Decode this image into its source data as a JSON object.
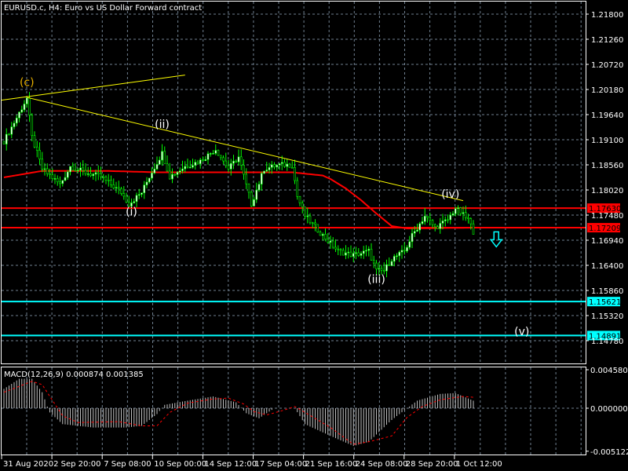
{
  "title": "EURUSD.c, H4:  Euro vs US Dollar Forward contract",
  "macd_label": "MACD(12,26,9) 0.000874 0.001385",
  "colors": {
    "bg": "#000000",
    "grid": "#708090",
    "candle": "#00ff00",
    "body_up": "#ffffff",
    "body_down": "#000000",
    "ma": "#ff0000",
    "trend": "#ffff00",
    "support": "#00ffff",
    "resist": "#ff0000",
    "signal": "#ff0000",
    "hist": "#c0c0c0"
  },
  "chart_data": [
    {
      "type": "candlestick",
      "symbol": "EURUSD.c",
      "timeframe": "H4",
      "ylim": [
        1.1451,
        1.2208
      ],
      "y_ticks": [
        "1.21800",
        "1.21260",
        "1.20720",
        "1.20180",
        "1.19640",
        "1.19100",
        "1.18560",
        "1.18020",
        "1.17480",
        "1.16940",
        "1.16400",
        "1.15860",
        "1.15320",
        "1.14780"
      ],
      "x_ticks": [
        "31 Aug 2020",
        "2 Sep 20:00",
        "7 Sep 08:00",
        "10 Sep 00:00",
        "14 Sep 12:00",
        "17 Sep 04:00",
        "21 Sep 16:00",
        "24 Sep 08:00",
        "28 Sep 20:00",
        "1 Oct 12:00"
      ],
      "bar_count": 185,
      "close_path": [
        [
          0,
          1.19066
        ],
        [
          5,
          1.19573
        ],
        [
          9,
          1.19994
        ],
        [
          11,
          1.19151
        ],
        [
          15,
          1.18476
        ],
        [
          22,
          1.18138
        ],
        [
          26,
          1.18526
        ],
        [
          32,
          1.18391
        ],
        [
          38,
          1.18307
        ],
        [
          46,
          1.17969
        ],
        [
          49,
          1.17716
        ],
        [
          54,
          1.17969
        ],
        [
          57,
          1.18307
        ],
        [
          62,
          1.18813
        ],
        [
          65,
          1.18307
        ],
        [
          71,
          1.18526
        ],
        [
          77,
          1.18644
        ],
        [
          83,
          1.18898
        ],
        [
          88,
          1.18476
        ],
        [
          92,
          1.18729
        ],
        [
          97,
          1.17716
        ],
        [
          102,
          1.18476
        ],
        [
          108,
          1.1856
        ],
        [
          113,
          1.1856
        ],
        [
          115,
          1.17885
        ],
        [
          118,
          1.17463
        ],
        [
          125,
          1.17041
        ],
        [
          131,
          1.16704
        ],
        [
          137,
          1.16619
        ],
        [
          143,
          1.16704
        ],
        [
          146,
          1.16282
        ],
        [
          149,
          1.16282
        ],
        [
          152,
          1.16535
        ],
        [
          157,
          1.16704
        ],
        [
          160,
          1.17041
        ],
        [
          165,
          1.17463
        ],
        [
          169,
          1.1721
        ],
        [
          174,
          1.17379
        ],
        [
          177,
          1.17632
        ],
        [
          182,
          1.17379
        ],
        [
          184,
          1.17126
        ]
      ],
      "moving_average": [
        [
          0,
          1.1829
        ],
        [
          15,
          1.1843
        ],
        [
          40,
          1.1843
        ],
        [
          60,
          1.184
        ],
        [
          113,
          1.184
        ],
        [
          125,
          1.1833
        ],
        [
          128,
          1.18256
        ],
        [
          134,
          1.18054
        ],
        [
          140,
          1.178
        ],
        [
          146,
          1.17514
        ],
        [
          152,
          1.17244
        ],
        [
          158,
          1.17193
        ],
        [
          184,
          1.1721
        ]
      ],
      "horizontal_levels": [
        {
          "label": "1.17630",
          "value": 1.1763,
          "kind": "resistance"
        },
        {
          "label": "1.17209",
          "value": 1.17209,
          "kind": "resistance"
        },
        {
          "label": "1.15621",
          "value": 1.15621,
          "kind": "support"
        },
        {
          "label": "1.14891",
          "value": 1.14891,
          "kind": "support"
        }
      ],
      "trendlines": [
        {
          "from": [
            -1,
            1.1995
          ],
          "to": [
            71,
            1.2049
          ]
        },
        {
          "from": [
            9,
            1.2001
          ],
          "to": [
            180,
            1.1779
          ]
        }
      ],
      "wave_labels": [
        {
          "text": "(c)",
          "bar": 9,
          "price": 1.2026,
          "color": "#e8b000"
        },
        {
          "text": "(ii)",
          "bar": 62,
          "price": 1.1935,
          "color": "#ffffff"
        },
        {
          "text": "(i)",
          "bar": 50,
          "price": 1.1747,
          "color": "#ffffff"
        },
        {
          "text": "(iii)",
          "bar": 146,
          "price": 1.1602,
          "color": "#ffffff"
        },
        {
          "text": "(iv)",
          "bar": 175,
          "price": 1.1785,
          "color": "#ffffff"
        },
        {
          "text": "(v)",
          "bar": 203,
          "price": 1.149,
          "color": "#ffffff"
        }
      ],
      "arrow": {
        "icon": "down-arrow",
        "bar": 193,
        "price": 1.1695
      }
    },
    {
      "type": "bar+line",
      "title": "MACD(12,26,9)",
      "main": 0.000874,
      "signal_value": 0.001385,
      "ylim": [
        -0.005122,
        0.00458
      ],
      "y_ticks": [
        "0.004580",
        "0.000000",
        "-0.005122"
      ],
      "histogram": [
        [
          0,
          0.0023
        ],
        [
          6,
          0.0035
        ],
        [
          11,
          0.0035
        ],
        [
          15,
          0.0019
        ],
        [
          17,
          0.0002
        ],
        [
          18,
          -0.0005
        ],
        [
          23,
          -0.0019
        ],
        [
          35,
          -0.0023
        ],
        [
          48,
          -0.0023
        ],
        [
          54,
          -0.0021
        ],
        [
          60,
          -0.0007
        ],
        [
          63,
          0.0004
        ],
        [
          72,
          0.0009
        ],
        [
          82,
          0.0014
        ],
        [
          91,
          0.0007
        ],
        [
          95,
          -0.0006
        ],
        [
          100,
          -0.0012
        ],
        [
          106,
          0
        ],
        [
          114,
          0
        ],
        [
          118,
          -0.0019
        ],
        [
          128,
          -0.0033
        ],
        [
          137,
          -0.0045
        ],
        [
          143,
          -0.004
        ],
        [
          152,
          -0.0014
        ],
        [
          162,
          0.0009
        ],
        [
          171,
          0.0017
        ],
        [
          177,
          0.0018
        ],
        [
          184,
          0.0009
        ]
      ],
      "signal": [
        [
          0,
          0.0019
        ],
        [
          6,
          0.0026
        ],
        [
          11,
          0.0032
        ],
        [
          15,
          0.0028
        ],
        [
          18,
          0.0014
        ],
        [
          23,
          -0.0009
        ],
        [
          29,
          -0.0017
        ],
        [
          45,
          -0.0016
        ],
        [
          54,
          -0.0021
        ],
        [
          60,
          -0.0021
        ],
        [
          65,
          -0.0005
        ],
        [
          72,
          0.0006
        ],
        [
          82,
          0.0011
        ],
        [
          88,
          0.0012
        ],
        [
          94,
          0.0005
        ],
        [
          98,
          -0.0004
        ],
        [
          103,
          -0.0008
        ],
        [
          109,
          -0.0003
        ],
        [
          114,
          0.0002
        ],
        [
          118,
          -0.0005
        ],
        [
          128,
          -0.0023
        ],
        [
          137,
          -0.0043
        ],
        [
          143,
          -0.004
        ],
        [
          152,
          -0.0033
        ],
        [
          158,
          -0.0011
        ],
        [
          164,
          0.0002
        ],
        [
          171,
          0.001
        ],
        [
          180,
          0.0014
        ],
        [
          184,
          0.0013
        ]
      ]
    }
  ]
}
